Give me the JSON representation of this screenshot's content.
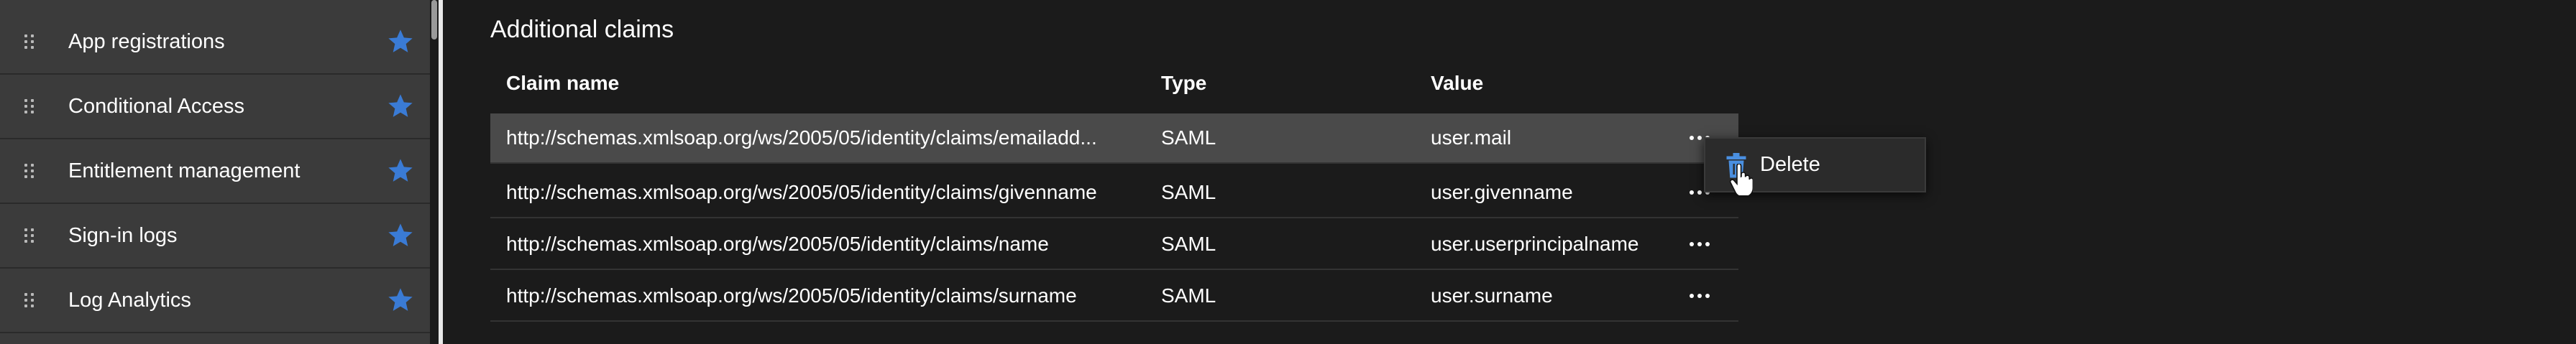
{
  "sidebar": {
    "items": [
      {
        "label": "App registrations",
        "favorite_icon": "star-icon"
      },
      {
        "label": "Conditional Access",
        "favorite_icon": "star-icon"
      },
      {
        "label": "Entitlement management",
        "favorite_icon": "star-icon"
      },
      {
        "label": "Sign-in logs",
        "favorite_icon": "star-icon"
      },
      {
        "label": "Log Analytics",
        "favorite_icon": "star-icon"
      }
    ]
  },
  "claims": {
    "title": "Additional claims",
    "columns": {
      "name": "Claim name",
      "type": "Type",
      "value": "Value"
    },
    "rows": [
      {
        "name": "http://schemas.xmlsoap.org/ws/2005/05/identity/claims/emailadd...",
        "type": "SAML",
        "value": "user.mail"
      },
      {
        "name": "http://schemas.xmlsoap.org/ws/2005/05/identity/claims/givenname",
        "type": "SAML",
        "value": "user.givenname"
      },
      {
        "name": "http://schemas.xmlsoap.org/ws/2005/05/identity/claims/name",
        "type": "SAML",
        "value": "user.userprincipalname"
      },
      {
        "name": "http://schemas.xmlsoap.org/ws/2005/05/identity/claims/surname",
        "type": "SAML",
        "value": "user.surname"
      }
    ]
  },
  "context_menu": {
    "delete_label": "Delete",
    "delete_icon": "trash-icon"
  },
  "colors": {
    "star": "#3a7bd5",
    "trash": "#4a8fe0",
    "sidebar_bg": "#3b3b3b",
    "page_bg": "#1b1b1b",
    "selected_row": "#4a4a4a"
  }
}
